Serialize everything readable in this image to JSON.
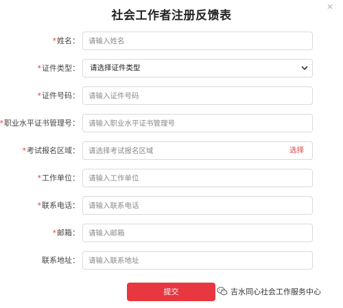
{
  "form": {
    "title": "社会工作者注册反馈表",
    "close_icon": "close-icon",
    "required_mark": "*",
    "fields": [
      {
        "label": "姓名：",
        "required": true,
        "placeholder": "请输入姓名"
      },
      {
        "label": "证件类型：",
        "required": true,
        "selected": "请选择证件类型"
      },
      {
        "label": "证件号码：",
        "required": true,
        "placeholder": "请输入证件号码"
      },
      {
        "label": "职业水平证书管理号：",
        "required": true,
        "placeholder": "请输入职业水平证书管理号"
      },
      {
        "label": "考试报名区域：",
        "required": true,
        "placeholder": "请选择考试报名区域",
        "action": "选择"
      },
      {
        "label": "工作单位：",
        "required": true,
        "placeholder": "请输入工作单位"
      },
      {
        "label": "联系电话：",
        "required": true,
        "placeholder": "请输入联系电话"
      },
      {
        "label": "邮箱：",
        "required": true,
        "placeholder": "请输入邮箱"
      },
      {
        "label": "联系地址：",
        "required": false,
        "placeholder": "请输入联系地址"
      }
    ],
    "submit_label": "提交"
  },
  "watermark": {
    "text": "吉水同心社会工作服务中心",
    "icon": "wechat-icon"
  },
  "colors": {
    "accent": "#e8373f",
    "required": "#e53935",
    "border": "#d9d9d9"
  }
}
